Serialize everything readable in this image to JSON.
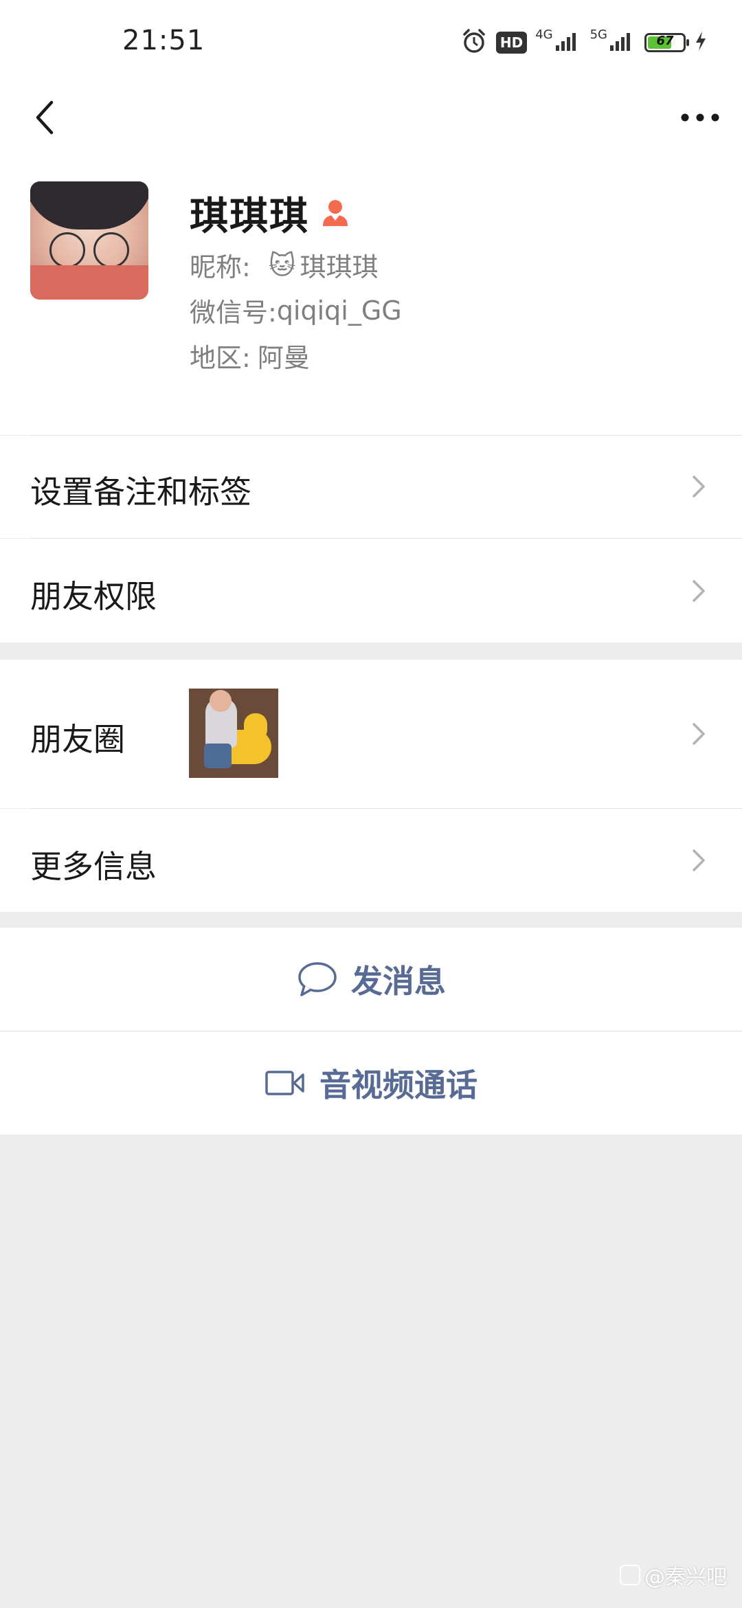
{
  "status_bar": {
    "time": "21:51",
    "hd": "HD",
    "net1": "4G",
    "net2": "5G",
    "battery": "67",
    "battery_level_percent": 67,
    "icons": [
      "alarm-icon",
      "signal-icon",
      "signal-icon",
      "battery-icon",
      "charging-icon"
    ]
  },
  "nav": {
    "back_icon": "chevron-left-icon",
    "more_icon": "more-dots-icon"
  },
  "profile": {
    "name": "琪琪琪",
    "gender_icon": "female-icon",
    "gender_color": "#f26b4f",
    "nickname_label": "昵称:",
    "nickname_emoji": "🐱",
    "nickname": "琪琪琪",
    "wechat_id_label": "微信号:",
    "wechat_id": "qiqiqi_GG",
    "region_label": "地区:",
    "region": "阿曼"
  },
  "rows": {
    "remark": "设置备注和标签",
    "permissions": "朋友权限",
    "moments": "朋友圈",
    "more_info": "更多信息"
  },
  "actions": {
    "message": "发消息",
    "video_call": "音视频通话",
    "accent": "#576b95"
  },
  "watermark": "@秦兴吧"
}
